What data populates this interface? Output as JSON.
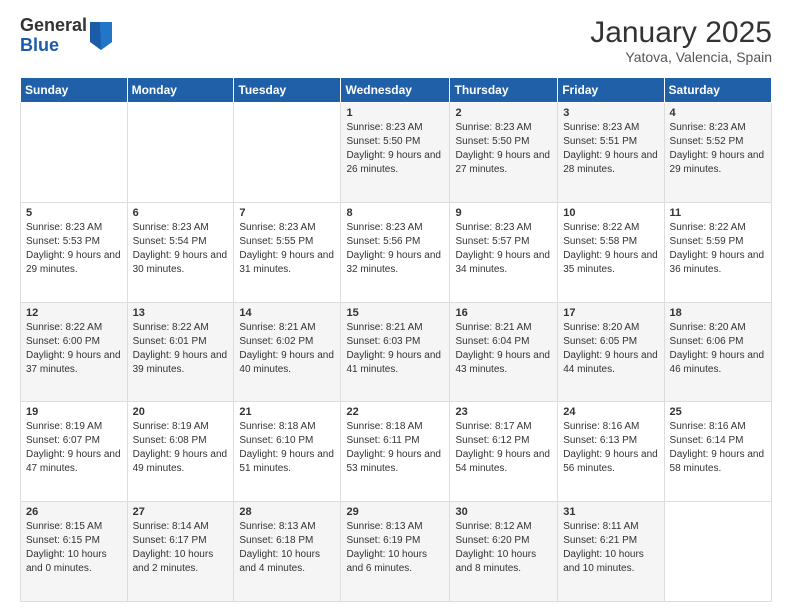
{
  "header": {
    "logo_general": "General",
    "logo_blue": "Blue",
    "month": "January 2025",
    "location": "Yatova, Valencia, Spain"
  },
  "weekdays": [
    "Sunday",
    "Monday",
    "Tuesday",
    "Wednesday",
    "Thursday",
    "Friday",
    "Saturday"
  ],
  "weeks": [
    [
      {
        "day": "",
        "sunrise": "",
        "sunset": "",
        "daylight": ""
      },
      {
        "day": "",
        "sunrise": "",
        "sunset": "",
        "daylight": ""
      },
      {
        "day": "",
        "sunrise": "",
        "sunset": "",
        "daylight": ""
      },
      {
        "day": "1",
        "sunrise": "8:23 AM",
        "sunset": "5:50 PM",
        "daylight": "9 hours and 26 minutes."
      },
      {
        "day": "2",
        "sunrise": "8:23 AM",
        "sunset": "5:50 PM",
        "daylight": "9 hours and 27 minutes."
      },
      {
        "day": "3",
        "sunrise": "8:23 AM",
        "sunset": "5:51 PM",
        "daylight": "9 hours and 28 minutes."
      },
      {
        "day": "4",
        "sunrise": "8:23 AM",
        "sunset": "5:52 PM",
        "daylight": "9 hours and 29 minutes."
      }
    ],
    [
      {
        "day": "5",
        "sunrise": "8:23 AM",
        "sunset": "5:53 PM",
        "daylight": "9 hours and 29 minutes."
      },
      {
        "day": "6",
        "sunrise": "8:23 AM",
        "sunset": "5:54 PM",
        "daylight": "9 hours and 30 minutes."
      },
      {
        "day": "7",
        "sunrise": "8:23 AM",
        "sunset": "5:55 PM",
        "daylight": "9 hours and 31 minutes."
      },
      {
        "day": "8",
        "sunrise": "8:23 AM",
        "sunset": "5:56 PM",
        "daylight": "9 hours and 32 minutes."
      },
      {
        "day": "9",
        "sunrise": "8:23 AM",
        "sunset": "5:57 PM",
        "daylight": "9 hours and 34 minutes."
      },
      {
        "day": "10",
        "sunrise": "8:22 AM",
        "sunset": "5:58 PM",
        "daylight": "9 hours and 35 minutes."
      },
      {
        "day": "11",
        "sunrise": "8:22 AM",
        "sunset": "5:59 PM",
        "daylight": "9 hours and 36 minutes."
      }
    ],
    [
      {
        "day": "12",
        "sunrise": "8:22 AM",
        "sunset": "6:00 PM",
        "daylight": "9 hours and 37 minutes."
      },
      {
        "day": "13",
        "sunrise": "8:22 AM",
        "sunset": "6:01 PM",
        "daylight": "9 hours and 39 minutes."
      },
      {
        "day": "14",
        "sunrise": "8:21 AM",
        "sunset": "6:02 PM",
        "daylight": "9 hours and 40 minutes."
      },
      {
        "day": "15",
        "sunrise": "8:21 AM",
        "sunset": "6:03 PM",
        "daylight": "9 hours and 41 minutes."
      },
      {
        "day": "16",
        "sunrise": "8:21 AM",
        "sunset": "6:04 PM",
        "daylight": "9 hours and 43 minutes."
      },
      {
        "day": "17",
        "sunrise": "8:20 AM",
        "sunset": "6:05 PM",
        "daylight": "9 hours and 44 minutes."
      },
      {
        "day": "18",
        "sunrise": "8:20 AM",
        "sunset": "6:06 PM",
        "daylight": "9 hours and 46 minutes."
      }
    ],
    [
      {
        "day": "19",
        "sunrise": "8:19 AM",
        "sunset": "6:07 PM",
        "daylight": "9 hours and 47 minutes."
      },
      {
        "day": "20",
        "sunrise": "8:19 AM",
        "sunset": "6:08 PM",
        "daylight": "9 hours and 49 minutes."
      },
      {
        "day": "21",
        "sunrise": "8:18 AM",
        "sunset": "6:10 PM",
        "daylight": "9 hours and 51 minutes."
      },
      {
        "day": "22",
        "sunrise": "8:18 AM",
        "sunset": "6:11 PM",
        "daylight": "9 hours and 53 minutes."
      },
      {
        "day": "23",
        "sunrise": "8:17 AM",
        "sunset": "6:12 PM",
        "daylight": "9 hours and 54 minutes."
      },
      {
        "day": "24",
        "sunrise": "8:16 AM",
        "sunset": "6:13 PM",
        "daylight": "9 hours and 56 minutes."
      },
      {
        "day": "25",
        "sunrise": "8:16 AM",
        "sunset": "6:14 PM",
        "daylight": "9 hours and 58 minutes."
      }
    ],
    [
      {
        "day": "26",
        "sunrise": "8:15 AM",
        "sunset": "6:15 PM",
        "daylight": "10 hours and 0 minutes."
      },
      {
        "day": "27",
        "sunrise": "8:14 AM",
        "sunset": "6:17 PM",
        "daylight": "10 hours and 2 minutes."
      },
      {
        "day": "28",
        "sunrise": "8:13 AM",
        "sunset": "6:18 PM",
        "daylight": "10 hours and 4 minutes."
      },
      {
        "day": "29",
        "sunrise": "8:13 AM",
        "sunset": "6:19 PM",
        "daylight": "10 hours and 6 minutes."
      },
      {
        "day": "30",
        "sunrise": "8:12 AM",
        "sunset": "6:20 PM",
        "daylight": "10 hours and 8 minutes."
      },
      {
        "day": "31",
        "sunrise": "8:11 AM",
        "sunset": "6:21 PM",
        "daylight": "10 hours and 10 minutes."
      },
      {
        "day": "",
        "sunrise": "",
        "sunset": "",
        "daylight": ""
      }
    ]
  ]
}
